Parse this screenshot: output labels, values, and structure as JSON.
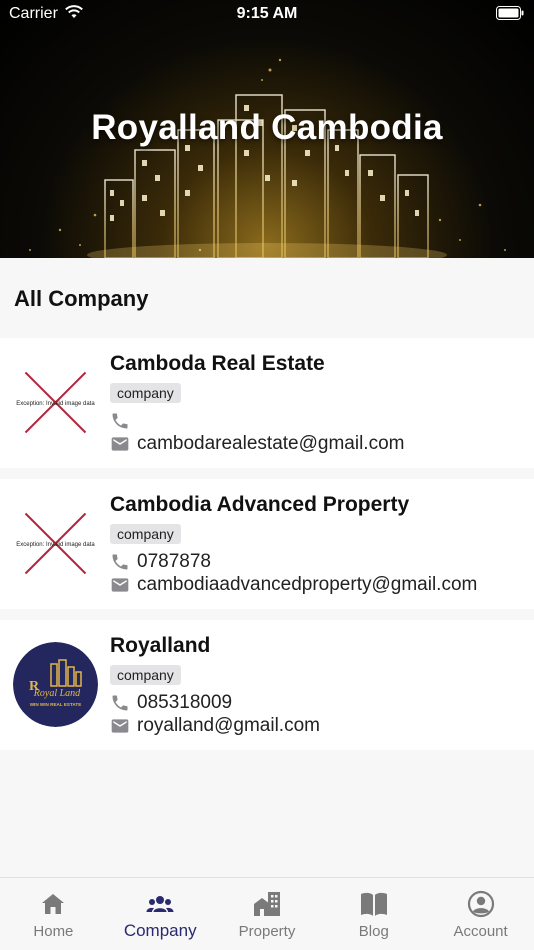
{
  "status_bar": {
    "carrier": "Carrier",
    "time": "9:15 AM"
  },
  "hero": {
    "title": "Royalland Cambodia"
  },
  "section": {
    "title": "All Company"
  },
  "companies": [
    {
      "name": "Camboda Real Estate",
      "tag": "company",
      "phone": "",
      "email": "cambodarealestate@gmail.com",
      "logo_error_text": "Exception: Invalid image data"
    },
    {
      "name": "Cambodia Advanced Property",
      "tag": "company",
      "phone": "0787878",
      "email": "cambodiaadvancedproperty@gmail.com",
      "logo_error_text": "Exception: Invalid image data"
    },
    {
      "name": "Royalland",
      "tag": "company",
      "phone": "085318009",
      "email": "royalland@gmail.com",
      "logo_text": "Royal Land",
      "logo_subtext": "WIN WIN REAL ESTATE"
    }
  ],
  "nav": [
    {
      "label": "Home",
      "icon": "home-icon"
    },
    {
      "label": "Company",
      "icon": "people-icon",
      "active": true
    },
    {
      "label": "Property",
      "icon": "building-icon"
    },
    {
      "label": "Blog",
      "icon": "book-icon"
    },
    {
      "label": "Account",
      "icon": "account-icon"
    }
  ],
  "colors": {
    "accent": "#2a2a6e",
    "inactive": "#7a7a7a",
    "error_cross": "#b0283c"
  }
}
